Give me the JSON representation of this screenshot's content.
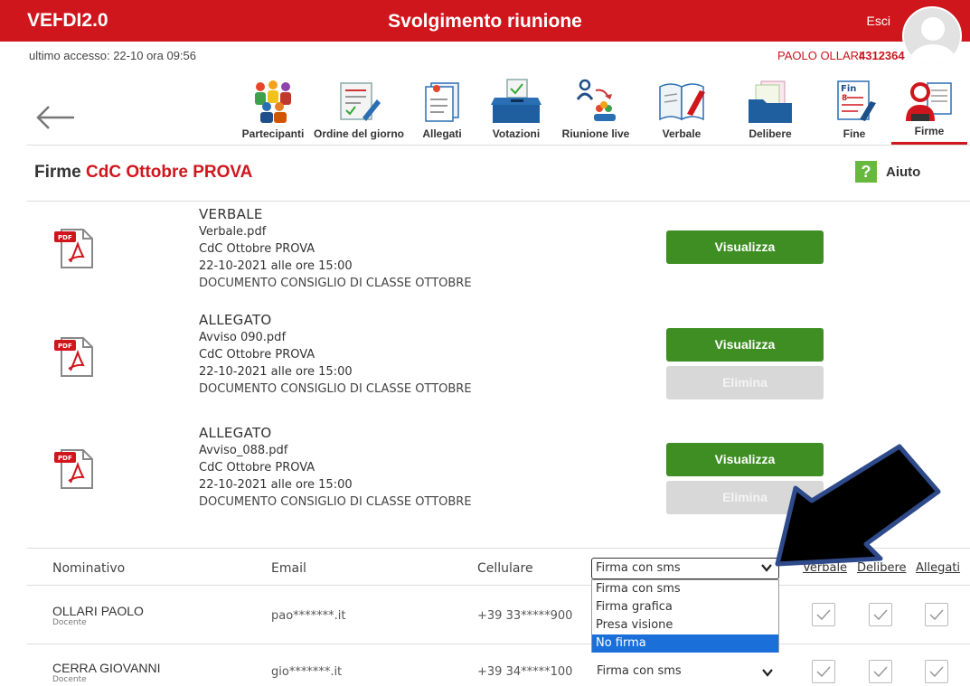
{
  "header": {
    "logo_main": "VE",
    "logo_rest": "DI",
    "logo_version": "2.0",
    "title": "Svolgimento riunione",
    "logout": "Esci"
  },
  "session": {
    "last_access": "ultimo accesso: 22-10 ora 09:56",
    "user_name": "PAOLO OLLARI",
    "user_code": "4312364"
  },
  "nav": {
    "items": [
      {
        "label": "Partecipanti",
        "icon": "participants-icon"
      },
      {
        "label": "Ordine del giorno",
        "icon": "agenda-icon"
      },
      {
        "label": "Allegati",
        "icon": "attachments-icon"
      },
      {
        "label": "Votazioni",
        "icon": "ballot-box-icon"
      },
      {
        "label": "Riunione live",
        "icon": "live-meeting-icon"
      },
      {
        "label": "Verbale",
        "icon": "minutes-book-icon"
      },
      {
        "label": "Delibere",
        "icon": "folder-icon"
      },
      {
        "label": "Fine",
        "icon": "finish-icon"
      },
      {
        "label": "Firme",
        "icon": "signatures-icon"
      }
    ],
    "active": "Firme"
  },
  "page": {
    "title_prefix": "Firme",
    "title_highlight": "CdC Ottobre PROVA",
    "help_label": "Aiuto",
    "help_symbol": "?"
  },
  "documents": [
    {
      "type": "VERBALE",
      "filename": "Verbale.pdf",
      "meeting": "CdC Ottobre PROVA",
      "datetime": "22-10-2021 alle ore 15:00",
      "description": "DOCUMENTO CONSIGLIO DI CLASSE OTTOBRE",
      "view_label": "Visualizza",
      "delete_label": ""
    },
    {
      "type": "ALLEGATO",
      "filename": "Avviso 090.pdf",
      "meeting": "CdC Ottobre PROVA",
      "datetime": "22-10-2021 alle ore 15:00",
      "description": "DOCUMENTO CONSIGLIO DI CLASSE OTTOBRE",
      "view_label": "Visualizza",
      "delete_label": "Elimina"
    },
    {
      "type": "ALLEGATO",
      "filename": "Avviso_088.pdf",
      "meeting": "CdC Ottobre PROVA",
      "datetime": "22-10-2021 alle ore 15:00",
      "description": "DOCUMENTO CONSIGLIO DI CLASSE OTTOBRE",
      "view_label": "Visualizza",
      "delete_label": "Elimina"
    }
  ],
  "pdf_badge": "PDF",
  "table": {
    "headers": {
      "name": "Nominativo",
      "email": "Email",
      "phone": "Cellulare",
      "verbale": "Verbale",
      "delibere": "Delibere",
      "allegati": "Allegati"
    },
    "signature_select": {
      "value": "Firma con sms",
      "options": [
        "Firma con sms",
        "Firma grafica",
        "Presa visione",
        "No firma"
      ],
      "highlighted": "No firma"
    },
    "rows": [
      {
        "name": "OLLARI PAOLO",
        "role": "Docente",
        "email": "pao*******.it",
        "phone": "+39 33*****900",
        "signature": "Firma con sms"
      },
      {
        "name": "CERRA GIOVANNI",
        "role": "Docente",
        "email": "gio*******.it",
        "phone": "+39 34*****100",
        "signature": "Firma con sms"
      }
    ]
  },
  "colors": {
    "brand_red": "#d0161d",
    "button_green": "#3e8e23",
    "disabled_grey": "#d8d8d8",
    "select_highlight": "#1a6fd8",
    "help_green": "#67b93e"
  }
}
